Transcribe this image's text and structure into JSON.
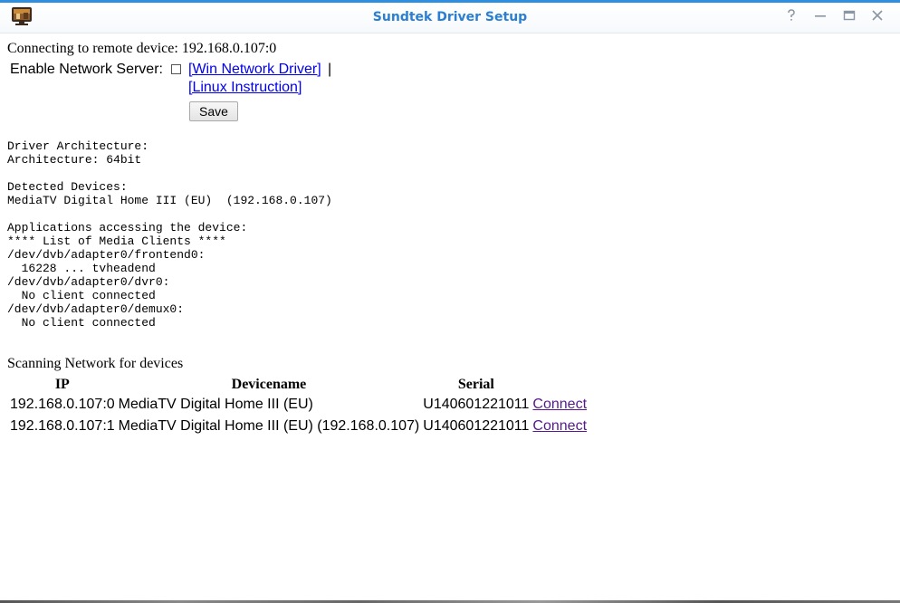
{
  "window": {
    "title": "Sundtek Driver Setup",
    "accent_color": "#2e8fe0",
    "title_color": "#2a7fd2",
    "app_icon": "tv-monitor-icon",
    "controls": {
      "help": "help-icon",
      "minimize": "minimize-icon",
      "maximize": "maximize-icon",
      "close": "close-icon"
    }
  },
  "connection": {
    "text": "Connecting to remote device: 192.168.0.107:0"
  },
  "network_server": {
    "label": "Enable Network Server:",
    "checked": false,
    "win_driver_link": "[Win Network Driver]",
    "separator": "|",
    "linux_link": "[Linux Instruction]",
    "save_label": "Save"
  },
  "driver_info": {
    "text": "Driver Architecture:\nArchitecture: 64bit\n\nDetected Devices:\nMediaTV Digital Home III (EU)  (192.168.0.107)\n\nApplications accessing the device:\n**** List of Media Clients ****\n/dev/dvb/adapter0/frontend0:\n  16228 ... tvheadend\n/dev/dvb/adapter0/dvr0:\n  No client connected\n/dev/dvb/adapter0/demux0:\n  No client connected"
  },
  "scan": {
    "heading": "Scanning Network for devices",
    "columns": [
      "IP",
      "Devicename",
      "Serial",
      ""
    ],
    "rows": [
      {
        "ip": "192.168.0.107:0",
        "devicename": "MediaTV Digital Home III (EU)",
        "serial": "U140601221011",
        "action": "Connect"
      },
      {
        "ip": "192.168.0.107:1",
        "devicename": "MediaTV Digital Home III (EU) (192.168.0.107)",
        "serial": "U140601221011",
        "action": "Connect"
      }
    ]
  }
}
